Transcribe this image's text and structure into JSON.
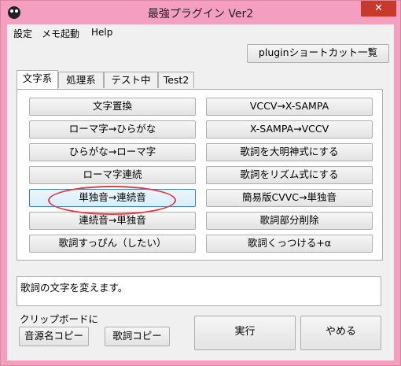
{
  "window": {
    "title": "最強プラグイン Ver2",
    "close_glyph": "✕"
  },
  "menu": [
    "設定",
    "メモ起動",
    "Help"
  ],
  "shortcut_button": "pluginショートカット一覧",
  "tabs": [
    "文字系",
    "処理系",
    "テスト中",
    "Test2"
  ],
  "left_buttons": [
    "文字置換",
    "ローマ字→ひらがな",
    "ひらがな→ローマ字",
    "ローマ字連続",
    "単独音→連続音",
    "連続音→単独音",
    "歌詞すっぴん（したい）"
  ],
  "right_buttons": [
    "VCCV→X-SAMPA",
    "X-SAMPA→VCCV",
    "歌詞を大明神式にする",
    "歌詞をリズム式にする",
    "簡易版CVVC→単独音",
    "歌詞部分削除",
    "歌詞くっつける+α"
  ],
  "description": "歌詞の文字を変えます。",
  "clipboard": {
    "label": "クリップボードに",
    "source_copy": "音源名コピー",
    "lyric_copy": "歌詞コピー"
  },
  "actions": {
    "run": "実行",
    "cancel": "やめる"
  },
  "colors": {
    "frame": "#f59fc0",
    "close": "#c7392b",
    "annotation": "#e53a44"
  }
}
